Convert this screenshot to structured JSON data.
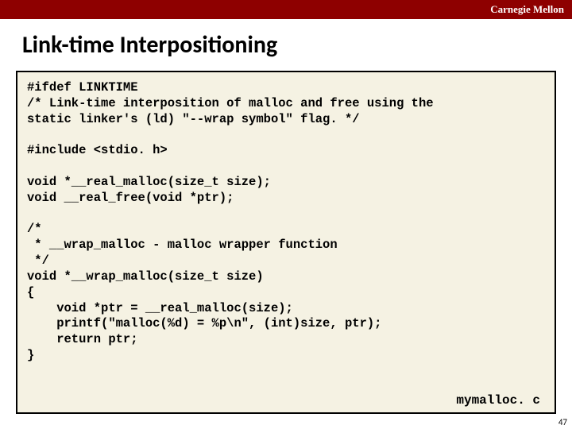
{
  "header": {
    "institution": "Carnegie Mellon"
  },
  "slide": {
    "title": "Link-time Interpositioning",
    "filename": "mymalloc. c",
    "page_number": "47"
  },
  "code": {
    "text": "#ifdef LINKTIME\n/* Link-time interposition of malloc and free using the\nstatic linker's (ld) \"--wrap symbol\" flag. */\n\n#include <stdio. h>\n\nvoid *__real_malloc(size_t size);\nvoid __real_free(void *ptr);\n\n/*\n * __wrap_malloc - malloc wrapper function\n */\nvoid *__wrap_malloc(size_t size)\n{\n    void *ptr = __real_malloc(size);\n    printf(\"malloc(%d) = %p\\n\", (int)size, ptr);\n    return ptr;\n}"
  }
}
